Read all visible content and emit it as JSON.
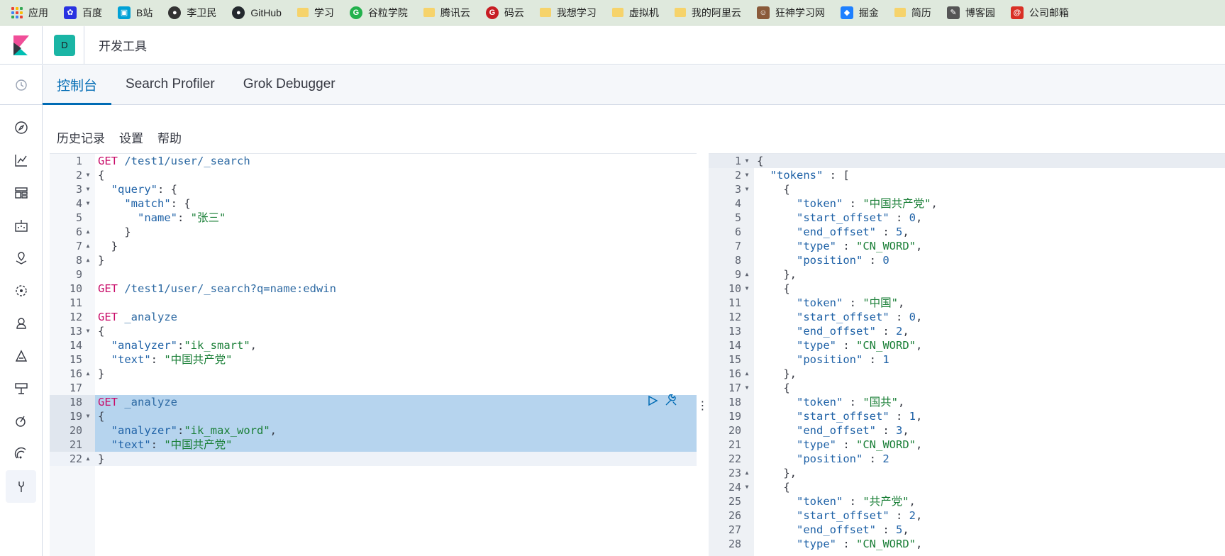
{
  "bookmarks": [
    {
      "label": "应用",
      "icon": "apps-icon"
    },
    {
      "label": "百度",
      "icon": "baidu-icon"
    },
    {
      "label": "B站",
      "icon": "bilibili-icon"
    },
    {
      "label": "李卫民",
      "icon": "globe-icon"
    },
    {
      "label": "GitHub",
      "icon": "github-icon"
    },
    {
      "label": "学习",
      "icon": "folder-icon"
    },
    {
      "label": "谷粒学院",
      "icon": "guli-icon"
    },
    {
      "label": "腾讯云",
      "icon": "folder-icon"
    },
    {
      "label": "码云",
      "icon": "gitee-icon"
    },
    {
      "label": "我想学习",
      "icon": "folder-icon"
    },
    {
      "label": "虚拟机",
      "icon": "folder-icon"
    },
    {
      "label": "我的阿里云",
      "icon": "folder-icon"
    },
    {
      "label": "狂神学习网",
      "icon": "avatar-icon"
    },
    {
      "label": "掘金",
      "icon": "juejin-icon"
    },
    {
      "label": "简历",
      "icon": "folder-icon"
    },
    {
      "label": "博客园",
      "icon": "cnblogs-icon"
    },
    {
      "label": "公司邮箱",
      "icon": "mail-icon"
    }
  ],
  "header": {
    "space_initial": "D",
    "breadcrumb": "开发工具"
  },
  "tabs": [
    {
      "label": "控制台",
      "active": true
    },
    {
      "label": "Search Profiler",
      "active": false
    },
    {
      "label": "Grok Debugger",
      "active": false
    }
  ],
  "submenu": {
    "history": "历史记录",
    "settings": "设置",
    "help": "帮助"
  },
  "request_editor": {
    "lines": [
      {
        "n": "1",
        "fold": "",
        "tokens": [
          [
            "k",
            "GET"
          ],
          [
            "p",
            " "
          ],
          [
            "u",
            "/test1/user/_search"
          ]
        ]
      },
      {
        "n": "2",
        "fold": "open",
        "tokens": [
          [
            "p",
            "{"
          ]
        ]
      },
      {
        "n": "3",
        "fold": "open",
        "tokens": [
          [
            "p",
            "  "
          ],
          [
            "prop",
            "\"query\""
          ],
          [
            "p",
            ": {"
          ]
        ]
      },
      {
        "n": "4",
        "fold": "open",
        "tokens": [
          [
            "p",
            "    "
          ],
          [
            "prop",
            "\"match\""
          ],
          [
            "p",
            ": {"
          ]
        ]
      },
      {
        "n": "5",
        "fold": "",
        "tokens": [
          [
            "p",
            "      "
          ],
          [
            "prop",
            "\"name\""
          ],
          [
            "p",
            ": "
          ],
          [
            "s",
            "\"张三\""
          ]
        ]
      },
      {
        "n": "6",
        "fold": "close",
        "tokens": [
          [
            "p",
            "    }"
          ]
        ]
      },
      {
        "n": "7",
        "fold": "close",
        "tokens": [
          [
            "p",
            "  }"
          ]
        ]
      },
      {
        "n": "8",
        "fold": "close",
        "tokens": [
          [
            "p",
            "}"
          ]
        ]
      },
      {
        "n": "9",
        "fold": "",
        "tokens": []
      },
      {
        "n": "10",
        "fold": "",
        "tokens": [
          [
            "k",
            "GET"
          ],
          [
            "p",
            " "
          ],
          [
            "u",
            "/test1/user/_search?q=name:edwin"
          ]
        ]
      },
      {
        "n": "11",
        "fold": "",
        "tokens": []
      },
      {
        "n": "12",
        "fold": "",
        "tokens": [
          [
            "k",
            "GET"
          ],
          [
            "p",
            " "
          ],
          [
            "u",
            "_analyze"
          ]
        ]
      },
      {
        "n": "13",
        "fold": "open",
        "tokens": [
          [
            "p",
            "{"
          ]
        ]
      },
      {
        "n": "14",
        "fold": "",
        "tokens": [
          [
            "p",
            "  "
          ],
          [
            "prop",
            "\"analyzer\""
          ],
          [
            "p",
            ":"
          ],
          [
            "s",
            "\"ik_smart\""
          ],
          [
            "p",
            ","
          ]
        ]
      },
      {
        "n": "15",
        "fold": "",
        "tokens": [
          [
            "p",
            "  "
          ],
          [
            "prop",
            "\"text\""
          ],
          [
            "p",
            ": "
          ],
          [
            "s",
            "\"中国共产党\""
          ]
        ]
      },
      {
        "n": "16",
        "fold": "close",
        "tokens": [
          [
            "p",
            "}"
          ]
        ]
      },
      {
        "n": "17",
        "fold": "",
        "tokens": []
      },
      {
        "n": "18",
        "fold": "",
        "sel": true,
        "tokens": [
          [
            "k",
            "GET"
          ],
          [
            "p",
            " "
          ],
          [
            "u",
            "_analyze"
          ]
        ]
      },
      {
        "n": "19",
        "fold": "open",
        "sel": true,
        "tokens": [
          [
            "p",
            "{"
          ]
        ]
      },
      {
        "n": "20",
        "fold": "",
        "sel": true,
        "tokens": [
          [
            "p",
            "  "
          ],
          [
            "prop",
            "\"analyzer\""
          ],
          [
            "p",
            ":"
          ],
          [
            "s",
            "\"ik_max_word\""
          ],
          [
            "p",
            ","
          ]
        ]
      },
      {
        "n": "21",
        "fold": "",
        "sel": true,
        "tokens": [
          [
            "p",
            "  "
          ],
          [
            "prop",
            "\"text\""
          ],
          [
            "p",
            ": "
          ],
          [
            "s",
            "\"中国共产党\""
          ]
        ]
      },
      {
        "n": "22",
        "fold": "close",
        "end": true,
        "tokens": [
          [
            "p",
            "}"
          ]
        ]
      }
    ]
  },
  "response_viewer": {
    "lines": [
      {
        "n": "1",
        "fold": "open",
        "tokens": [
          [
            "p",
            "{"
          ]
        ]
      },
      {
        "n": "2",
        "fold": "open",
        "tokens": [
          [
            "p",
            "  "
          ],
          [
            "prop",
            "\"tokens\""
          ],
          [
            "p",
            " : ["
          ]
        ]
      },
      {
        "n": "3",
        "fold": "open",
        "tokens": [
          [
            "p",
            "    {"
          ]
        ]
      },
      {
        "n": "4",
        "fold": "",
        "tokens": [
          [
            "p",
            "      "
          ],
          [
            "prop",
            "\"token\""
          ],
          [
            "p",
            " : "
          ],
          [
            "s",
            "\"中国共产党\""
          ],
          [
            "p",
            ","
          ]
        ]
      },
      {
        "n": "5",
        "fold": "",
        "tokens": [
          [
            "p",
            "      "
          ],
          [
            "prop",
            "\"start_offset\""
          ],
          [
            "p",
            " : "
          ],
          [
            "n",
            "0"
          ],
          [
            "p",
            ","
          ]
        ]
      },
      {
        "n": "6",
        "fold": "",
        "tokens": [
          [
            "p",
            "      "
          ],
          [
            "prop",
            "\"end_offset\""
          ],
          [
            "p",
            " : "
          ],
          [
            "n",
            "5"
          ],
          [
            "p",
            ","
          ]
        ]
      },
      {
        "n": "7",
        "fold": "",
        "tokens": [
          [
            "p",
            "      "
          ],
          [
            "prop",
            "\"type\""
          ],
          [
            "p",
            " : "
          ],
          [
            "s",
            "\"CN_WORD\""
          ],
          [
            "p",
            ","
          ]
        ]
      },
      {
        "n": "8",
        "fold": "",
        "tokens": [
          [
            "p",
            "      "
          ],
          [
            "prop",
            "\"position\""
          ],
          [
            "p",
            " : "
          ],
          [
            "n",
            "0"
          ]
        ]
      },
      {
        "n": "9",
        "fold": "close",
        "tokens": [
          [
            "p",
            "    },"
          ]
        ]
      },
      {
        "n": "10",
        "fold": "open",
        "tokens": [
          [
            "p",
            "    {"
          ]
        ]
      },
      {
        "n": "11",
        "fold": "",
        "tokens": [
          [
            "p",
            "      "
          ],
          [
            "prop",
            "\"token\""
          ],
          [
            "p",
            " : "
          ],
          [
            "s",
            "\"中国\""
          ],
          [
            "p",
            ","
          ]
        ]
      },
      {
        "n": "12",
        "fold": "",
        "tokens": [
          [
            "p",
            "      "
          ],
          [
            "prop",
            "\"start_offset\""
          ],
          [
            "p",
            " : "
          ],
          [
            "n",
            "0"
          ],
          [
            "p",
            ","
          ]
        ]
      },
      {
        "n": "13",
        "fold": "",
        "tokens": [
          [
            "p",
            "      "
          ],
          [
            "prop",
            "\"end_offset\""
          ],
          [
            "p",
            " : "
          ],
          [
            "n",
            "2"
          ],
          [
            "p",
            ","
          ]
        ]
      },
      {
        "n": "14",
        "fold": "",
        "tokens": [
          [
            "p",
            "      "
          ],
          [
            "prop",
            "\"type\""
          ],
          [
            "p",
            " : "
          ],
          [
            "s",
            "\"CN_WORD\""
          ],
          [
            "p",
            ","
          ]
        ]
      },
      {
        "n": "15",
        "fold": "",
        "tokens": [
          [
            "p",
            "      "
          ],
          [
            "prop",
            "\"position\""
          ],
          [
            "p",
            " : "
          ],
          [
            "n",
            "1"
          ]
        ]
      },
      {
        "n": "16",
        "fold": "close",
        "tokens": [
          [
            "p",
            "    },"
          ]
        ]
      },
      {
        "n": "17",
        "fold": "open",
        "tokens": [
          [
            "p",
            "    {"
          ]
        ]
      },
      {
        "n": "18",
        "fold": "",
        "tokens": [
          [
            "p",
            "      "
          ],
          [
            "prop",
            "\"token\""
          ],
          [
            "p",
            " : "
          ],
          [
            "s",
            "\"国共\""
          ],
          [
            "p",
            ","
          ]
        ]
      },
      {
        "n": "19",
        "fold": "",
        "tokens": [
          [
            "p",
            "      "
          ],
          [
            "prop",
            "\"start_offset\""
          ],
          [
            "p",
            " : "
          ],
          [
            "n",
            "1"
          ],
          [
            "p",
            ","
          ]
        ]
      },
      {
        "n": "20",
        "fold": "",
        "tokens": [
          [
            "p",
            "      "
          ],
          [
            "prop",
            "\"end_offset\""
          ],
          [
            "p",
            " : "
          ],
          [
            "n",
            "3"
          ],
          [
            "p",
            ","
          ]
        ]
      },
      {
        "n": "21",
        "fold": "",
        "tokens": [
          [
            "p",
            "      "
          ],
          [
            "prop",
            "\"type\""
          ],
          [
            "p",
            " : "
          ],
          [
            "s",
            "\"CN_WORD\""
          ],
          [
            "p",
            ","
          ]
        ]
      },
      {
        "n": "22",
        "fold": "",
        "tokens": [
          [
            "p",
            "      "
          ],
          [
            "prop",
            "\"position\""
          ],
          [
            "p",
            " : "
          ],
          [
            "n",
            "2"
          ]
        ]
      },
      {
        "n": "23",
        "fold": "close",
        "tokens": [
          [
            "p",
            "    },"
          ]
        ]
      },
      {
        "n": "24",
        "fold": "open",
        "tokens": [
          [
            "p",
            "    {"
          ]
        ]
      },
      {
        "n": "25",
        "fold": "",
        "tokens": [
          [
            "p",
            "      "
          ],
          [
            "prop",
            "\"token\""
          ],
          [
            "p",
            " : "
          ],
          [
            "s",
            "\"共产党\""
          ],
          [
            "p",
            ","
          ]
        ]
      },
      {
        "n": "26",
        "fold": "",
        "tokens": [
          [
            "p",
            "      "
          ],
          [
            "prop",
            "\"start_offset\""
          ],
          [
            "p",
            " : "
          ],
          [
            "n",
            "2"
          ],
          [
            "p",
            ","
          ]
        ]
      },
      {
        "n": "27",
        "fold": "",
        "tokens": [
          [
            "p",
            "      "
          ],
          [
            "prop",
            "\"end_offset\""
          ],
          [
            "p",
            " : "
          ],
          [
            "n",
            "5"
          ],
          [
            "p",
            ","
          ]
        ]
      },
      {
        "n": "28",
        "fold": "",
        "tokens": [
          [
            "p",
            "      "
          ],
          [
            "prop",
            "\"type\""
          ],
          [
            "p",
            " : "
          ],
          [
            "s",
            "\"CN_WORD\""
          ],
          [
            "p",
            ","
          ]
        ]
      }
    ]
  },
  "colors": {
    "accent": "#006bb4",
    "keyword": "#c80a68",
    "string": "#1a7f37",
    "selection": "#b6d4ee"
  }
}
